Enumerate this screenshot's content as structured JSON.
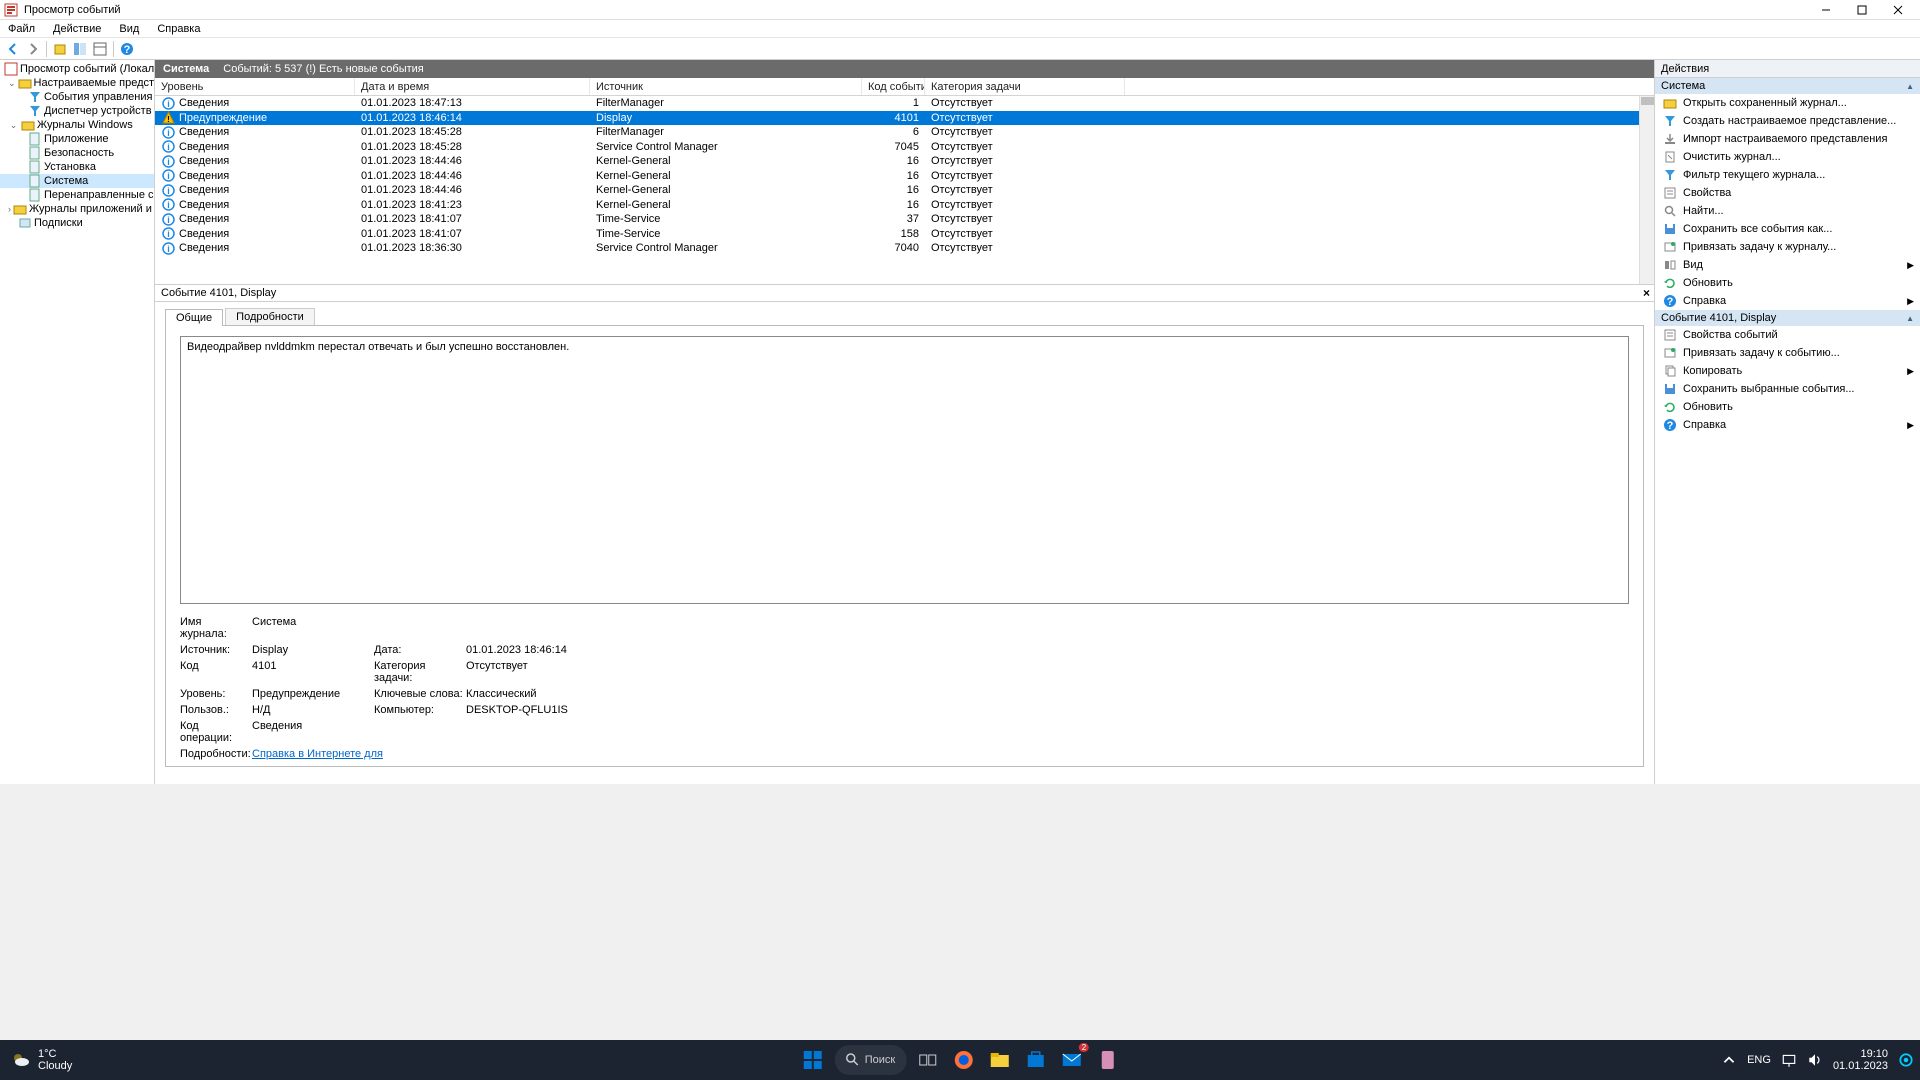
{
  "window": {
    "title": "Просмотр событий"
  },
  "menubar": [
    "Файл",
    "Действие",
    "Вид",
    "Справка"
  ],
  "tree": {
    "root": "Просмотр событий (Локальный",
    "custom_views": "Настраиваемые представл",
    "custom_children": [
      "События управления",
      "Диспетчер устройств - l"
    ],
    "win_logs": "Журналы Windows",
    "win_children": [
      "Приложение",
      "Безопасность",
      "Установка",
      "Система",
      "Перенаправленные соб"
    ],
    "app_logs": "Журналы приложений и сл",
    "subs": "Подписки"
  },
  "log_header": {
    "name": "Система",
    "count_label": "Событий: 5 537 (!) Есть новые события"
  },
  "columns": {
    "level": "Уровень",
    "date": "Дата и время",
    "source": "Источник",
    "code": "Код события",
    "category": "Категория задачи"
  },
  "events": [
    {
      "level": "Сведения",
      "type": "info",
      "date": "01.01.2023 18:47:13",
      "source": "FilterManager",
      "code": "1",
      "category": "Отсутствует",
      "selected": false
    },
    {
      "level": "Предупреждение",
      "type": "warn",
      "date": "01.01.2023 18:46:14",
      "source": "Display",
      "code": "4101",
      "category": "Отсутствует",
      "selected": true
    },
    {
      "level": "Сведения",
      "type": "info",
      "date": "01.01.2023 18:45:28",
      "source": "FilterManager",
      "code": "6",
      "category": "Отсутствует",
      "selected": false
    },
    {
      "level": "Сведения",
      "type": "info",
      "date": "01.01.2023 18:45:28",
      "source": "Service Control Manager",
      "code": "7045",
      "category": "Отсутствует",
      "selected": false
    },
    {
      "level": "Сведения",
      "type": "info",
      "date": "01.01.2023 18:44:46",
      "source": "Kernel-General",
      "code": "16",
      "category": "Отсутствует",
      "selected": false
    },
    {
      "level": "Сведения",
      "type": "info",
      "date": "01.01.2023 18:44:46",
      "source": "Kernel-General",
      "code": "16",
      "category": "Отсутствует",
      "selected": false
    },
    {
      "level": "Сведения",
      "type": "info",
      "date": "01.01.2023 18:44:46",
      "source": "Kernel-General",
      "code": "16",
      "category": "Отсутствует",
      "selected": false
    },
    {
      "level": "Сведения",
      "type": "info",
      "date": "01.01.2023 18:41:23",
      "source": "Kernel-General",
      "code": "16",
      "category": "Отсутствует",
      "selected": false
    },
    {
      "level": "Сведения",
      "type": "info",
      "date": "01.01.2023 18:41:07",
      "source": "Time-Service",
      "code": "37",
      "category": "Отсутствует",
      "selected": false
    },
    {
      "level": "Сведения",
      "type": "info",
      "date": "01.01.2023 18:41:07",
      "source": "Time-Service",
      "code": "158",
      "category": "Отсутствует",
      "selected": false
    },
    {
      "level": "Сведения",
      "type": "info",
      "date": "01.01.2023 18:36:30",
      "source": "Service Control Manager",
      "code": "7040",
      "category": "Отсутствует",
      "selected": false
    }
  ],
  "detail": {
    "header": "Событие 4101, Display",
    "tabs": {
      "general": "Общие",
      "details": "Подробности"
    },
    "description": "Видеодрайвер nvlddmkm перестал отвечать и был успешно восстановлен.",
    "labels": {
      "log_name": "Имя журнала:",
      "source": "Источник:",
      "code": "Код",
      "level": "Уровень:",
      "user": "Пользов.:",
      "opcode": "Код операции:",
      "more": "Подробности:",
      "date": "Дата:",
      "category": "Категория задачи:",
      "keywords": "Ключевые слова:",
      "computer": "Компьютер:"
    },
    "values": {
      "log_name": "Система",
      "source": "Display",
      "date": "01.01.2023 18:46:14",
      "code": "4101",
      "category": "Отсутствует",
      "level": "Предупреждение",
      "keywords": "Классический",
      "user": "Н/Д",
      "computer": "DESKTOP-QFLU1IS",
      "opcode": "Сведения",
      "more_link": "Справка в Интернете для "
    }
  },
  "actions": {
    "title": "Действия",
    "system_section": "Система",
    "system_items": [
      "Открыть сохраненный журнал...",
      "Создать настраиваемое представление...",
      "Импорт настраиваемого представления",
      "Очистить журнал...",
      "Фильтр текущего журнала...",
      "Свойства",
      "Найти...",
      "Сохранить все события как...",
      "Привязать задачу к журналу...",
      "Вид",
      "Обновить",
      "Справка"
    ],
    "event_section": "Событие 4101, Display",
    "event_items": [
      "Свойства событий",
      "Привязать задачу к событию...",
      "Копировать",
      "Сохранить выбранные события...",
      "Обновить",
      "Справка"
    ]
  },
  "taskbar": {
    "weather_temp": "1°C",
    "weather_desc": "Cloudy",
    "search": "Поиск",
    "lang": "ENG",
    "time": "19:10",
    "date": "01.01.2023"
  }
}
